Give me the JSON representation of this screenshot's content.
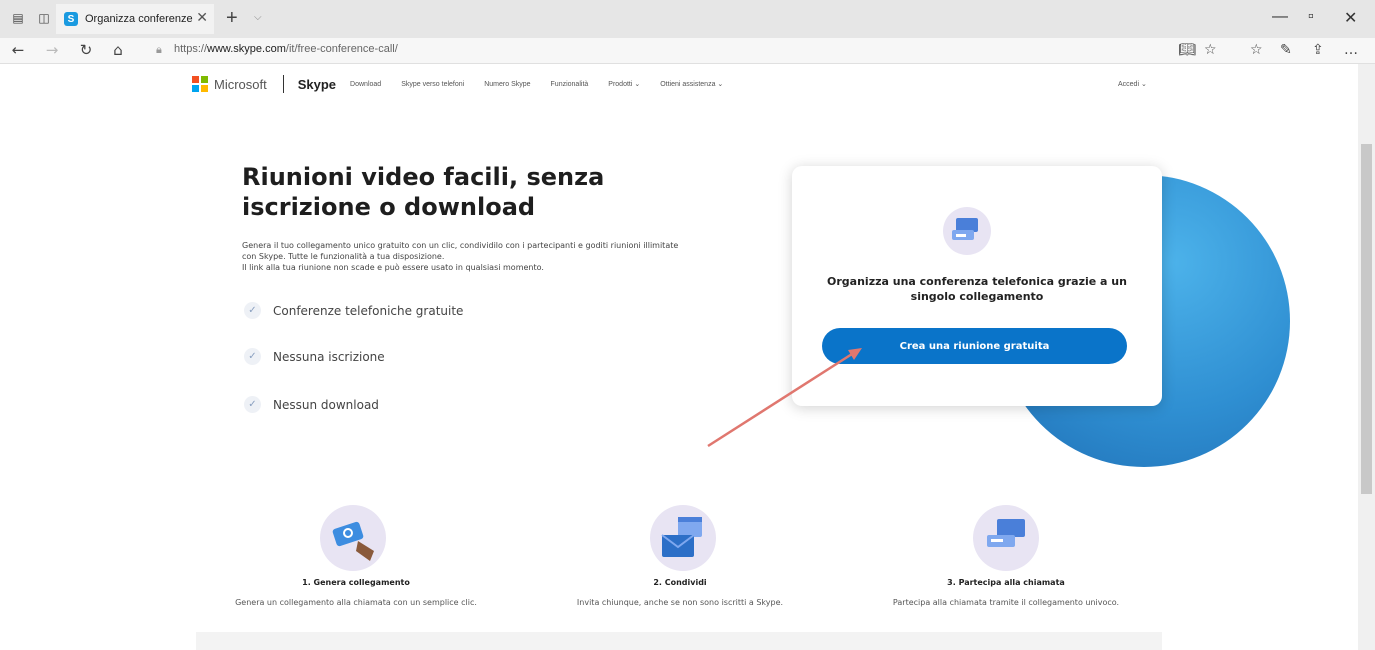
{
  "browser": {
    "tab_title": "Organizza conferenze te",
    "tab_favicon": "S",
    "url_prefix": "https://",
    "url_domain": "www.skype.com",
    "url_path": "/it/free-conference-call/"
  },
  "sitenav": {
    "microsoft": "Microsoft",
    "brand": "Skype",
    "links": [
      "Download",
      "Skype verso telefoni",
      "Numero Skype",
      "Funzionalità",
      "Prodotti ⌄",
      "Ottieni assistenza ⌄"
    ],
    "signin": "Accedi ⌄"
  },
  "hero": {
    "title": "Riunioni video facili, senza iscrizione o download",
    "desc_line1": "Genera il tuo collegamento unico gratuito con un clic, condividilo con i partecipanti e goditi riunioni illimitate con Skype. Tutte le funzionalità a tua disposizione.",
    "desc_line2": "Il link alla tua riunione non scade e può essere usato in qualsiasi momento.",
    "features": [
      "Conferenze telefoniche gratuite",
      "Nessuna iscrizione",
      "Nessun download"
    ]
  },
  "card": {
    "title": "Organizza una conferenza telefonica grazie a un singolo collegamento",
    "button": "Crea una riunione gratuita"
  },
  "steps": [
    {
      "title": "1. Genera collegamento",
      "desc": "Genera un collegamento alla chiamata con un semplice clic."
    },
    {
      "title": "2. Condividi",
      "desc": "Invita chiunque, anche se non sono iscritti a Skype."
    },
    {
      "title": "3. Partecipa alla chiamata",
      "desc": "Partecipa alla chiamata tramite il collegamento univoco."
    }
  ],
  "colors": {
    "accent": "#0a74c9",
    "circle": "#2f8fd2",
    "annotation_arrow": "#e0776f"
  },
  "icons": {
    "microsoft_logo": "microsoft-logo-icon",
    "check": "check-icon"
  }
}
